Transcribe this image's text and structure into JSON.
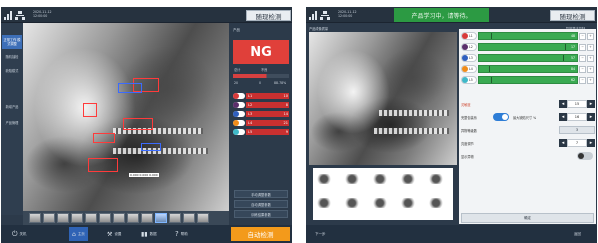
{
  "left": {
    "datetime": [
      "2020-11-12",
      "12:00:00"
    ],
    "page_title": "随现检测",
    "sidebar": [
      {
        "label": "正常工作 模式调整",
        "active": true
      },
      {
        "label": "随机抽检",
        "active": false
      },
      {
        "label": "缺陷模式",
        "active": false
      },
      {
        "label": "新增产品",
        "active": false
      },
      {
        "label": "产品管理",
        "active": false
      }
    ],
    "result_panel": {
      "title": "产品",
      "result": "NG",
      "stats_labels": [
        "总计",
        "不良"
      ],
      "stats_numbers": [
        "20",
        "0",
        "88.78%"
      ],
      "defects": [
        {
          "label": "L1",
          "value": "10",
          "color": "#d83a3a"
        },
        {
          "label": "L2",
          "value": "8",
          "color": "#5a2e6b"
        },
        {
          "label": "L3",
          "value": "14",
          "color": "#2f5fbf"
        },
        {
          "label": "L4",
          "value": "21",
          "color": "#f08c1a"
        },
        {
          "label": "L5",
          "value": "9",
          "color": "#3fb8c8"
        }
      ],
      "buttons": [
        "手动调整参数",
        "自动调整参数",
        "训练结果参数"
      ]
    },
    "annotation_text": "0.000 0.000 0.000",
    "bottom_nav": [
      {
        "label": "关机",
        "icon": "power-icon",
        "active": false
      },
      {
        "label": "主页",
        "icon": "home-icon",
        "active": true
      },
      {
        "label": "设置",
        "icon": "tools-icon",
        "active": false
      },
      {
        "label": "数据",
        "icon": "chart-icon",
        "active": false
      },
      {
        "label": "帮助",
        "icon": "help-icon",
        "active": false
      }
    ],
    "start_button": "自动检测"
  },
  "right": {
    "datetime": [
      "2020-11-12",
      "12:00:00"
    ],
    "status": "产品学习中，请等待。",
    "page_title": "随现检测",
    "left_label": "产品成像质量",
    "right_label": "智能算法控制",
    "rows": [
      {
        "label": "L1",
        "color": "#d83a3a",
        "value": "48",
        "marker": 0.12
      },
      {
        "label": "L2",
        "color": "#5a2e6b",
        "value": "17",
        "marker": 0.88
      },
      {
        "label": "L3",
        "color": "#2f5fbf",
        "value": "57",
        "marker": 0.86
      },
      {
        "label": "L4",
        "color": "#f08c1a",
        "value": "84",
        "marker": 0.1
      },
      {
        "label": "L5",
        "color": "#3fb8c8",
        "value": "62",
        "marker": 0.12
      }
    ],
    "settings": {
      "sensitivity_label": "灵敏度",
      "sensitivity_value": "15",
      "fixed_position_label": "完整包装系",
      "max_label": "最大缺陷尺寸 %",
      "max_value": "16",
      "abnormal_label": "异物等级数",
      "abnormal_value": "3",
      "position_label": "亮度调节",
      "position_value": "7",
      "show_label": "显示异物"
    },
    "confirm_button": "确定",
    "prev_button": "下一步",
    "return_button": "返回"
  }
}
